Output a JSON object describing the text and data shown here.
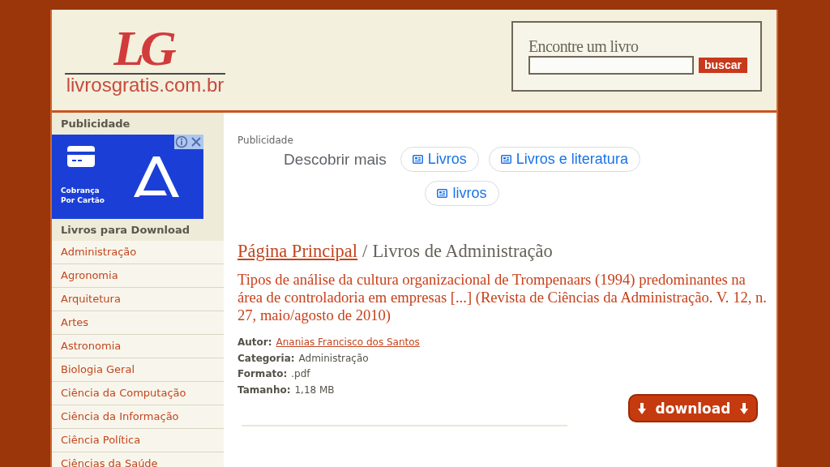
{
  "header": {
    "logo": {
      "mark": "LG",
      "wordmark": "livrosgratis.com.br"
    },
    "search": {
      "label": "Encontre um livro",
      "button": "buscar"
    }
  },
  "sidebar": {
    "ad_heading": "Publicidade",
    "ad": {
      "caption": [
        "Cobrança",
        "Por Cartão"
      ]
    },
    "section_heading": "Livros para Download",
    "items": [
      "Administração",
      "Agronomia",
      "Arquitetura",
      "Artes",
      "Astronomia",
      "Biologia Geral",
      "Ciência da Computação",
      "Ciência da Informação",
      "Ciência Política",
      "Ciências da Saúde"
    ]
  },
  "main": {
    "ad_label": "Publicidade",
    "discover": {
      "label": "Descobrir mais",
      "chips": [
        "Livros",
        "Livros e literatura",
        "livros"
      ]
    },
    "breadcrumb": {
      "link": "Página Principal",
      "separator": "/",
      "current": "Livros de Administração"
    },
    "title": "Tipos de análise da cultura organizacional de Trompenaars (1994) predominantes na área de controladoria em empresas [...] (Revista de Ciências da Administração. V. 12, n. 27, maio/agosto de 2010)",
    "details": [
      {
        "kind": "link",
        "label": "Autor:",
        "value": "Ananias Francisco dos Santos"
      },
      {
        "kind": "text",
        "label": "Categoria:",
        "value": "Administração"
      },
      {
        "kind": "text",
        "label": "Formato:",
        "value": ".pdf"
      },
      {
        "kind": "text",
        "label": "Tamanho:",
        "value": "1,18 MB"
      }
    ],
    "download_button": "download"
  }
}
